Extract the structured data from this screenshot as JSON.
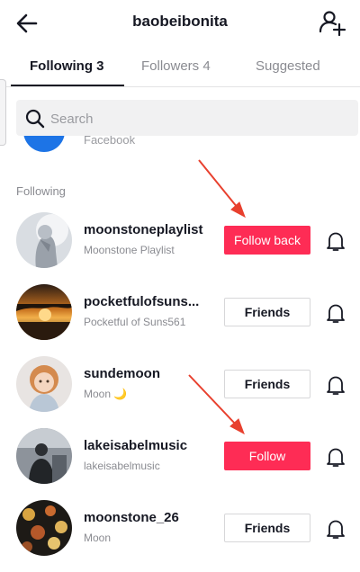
{
  "header": {
    "title": "baobeibonita",
    "back_icon": "arrow-left-icon",
    "add_user_icon": "add-user-icon"
  },
  "tabs": [
    {
      "label": "Following 3",
      "active": true
    },
    {
      "label": "Followers 4",
      "active": false
    },
    {
      "label": "Suggested",
      "active": false
    }
  ],
  "search": {
    "placeholder": "Search",
    "icon": "search-icon"
  },
  "partial_item": {
    "label": "Facebook",
    "icon_color": "#1d74e6"
  },
  "section_label": "Following",
  "rows": [
    {
      "username": "moonstoneplaylist",
      "nickname": "Moonstone Playlist",
      "button": "Follow back",
      "button_style": "red"
    },
    {
      "username": "pocketfulofsuns...",
      "nickname": "Pocketful of Suns561",
      "button": "Friends",
      "button_style": "outline"
    },
    {
      "username": "sundemoon",
      "nickname": "Moon 🌙",
      "button": "Friends",
      "button_style": "outline"
    },
    {
      "username": "lakeisabelmusic",
      "nickname": "lakeisabelmusic",
      "button": "Follow",
      "button_style": "red"
    },
    {
      "username": "moonstone_26",
      "nickname": "Moon",
      "button": "Friends",
      "button_style": "outline"
    }
  ],
  "colors": {
    "accent": "#fe2c55",
    "annotation_arrow": "#e8402e",
    "text": "#161823",
    "secondary_text": "#8a8b91"
  }
}
